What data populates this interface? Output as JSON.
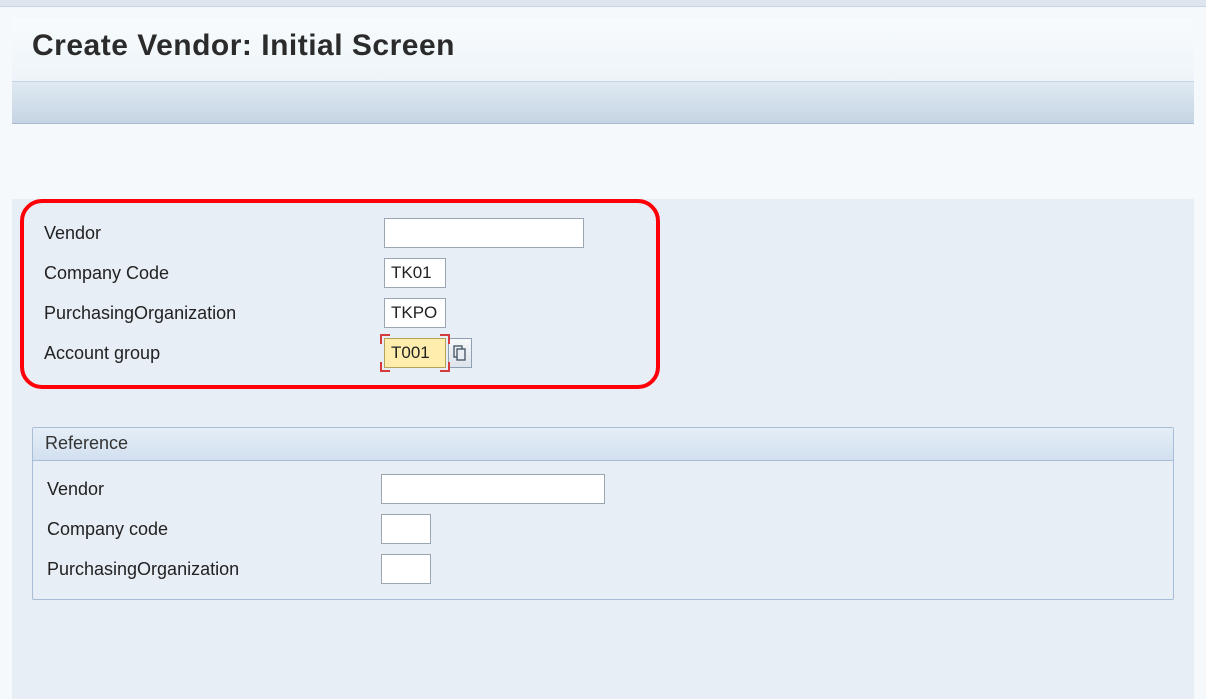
{
  "page_title": "Create Vendor:  Initial Screen",
  "main": {
    "vendor": {
      "label": "Vendor",
      "value": ""
    },
    "company_code": {
      "label": "Company Code",
      "value": "TK01"
    },
    "purchasing_org": {
      "label": "PurchasingOrganization",
      "value": "TKPO"
    },
    "account_group": {
      "label": "Account group",
      "value": "T001"
    }
  },
  "reference": {
    "title": "Reference",
    "vendor": {
      "label": "Vendor",
      "value": ""
    },
    "company_code": {
      "label": "Company code",
      "value": ""
    },
    "purchasing_org": {
      "label": "PurchasingOrganization",
      "value": ""
    }
  },
  "icons": {
    "search_help": "search-help-icon"
  }
}
